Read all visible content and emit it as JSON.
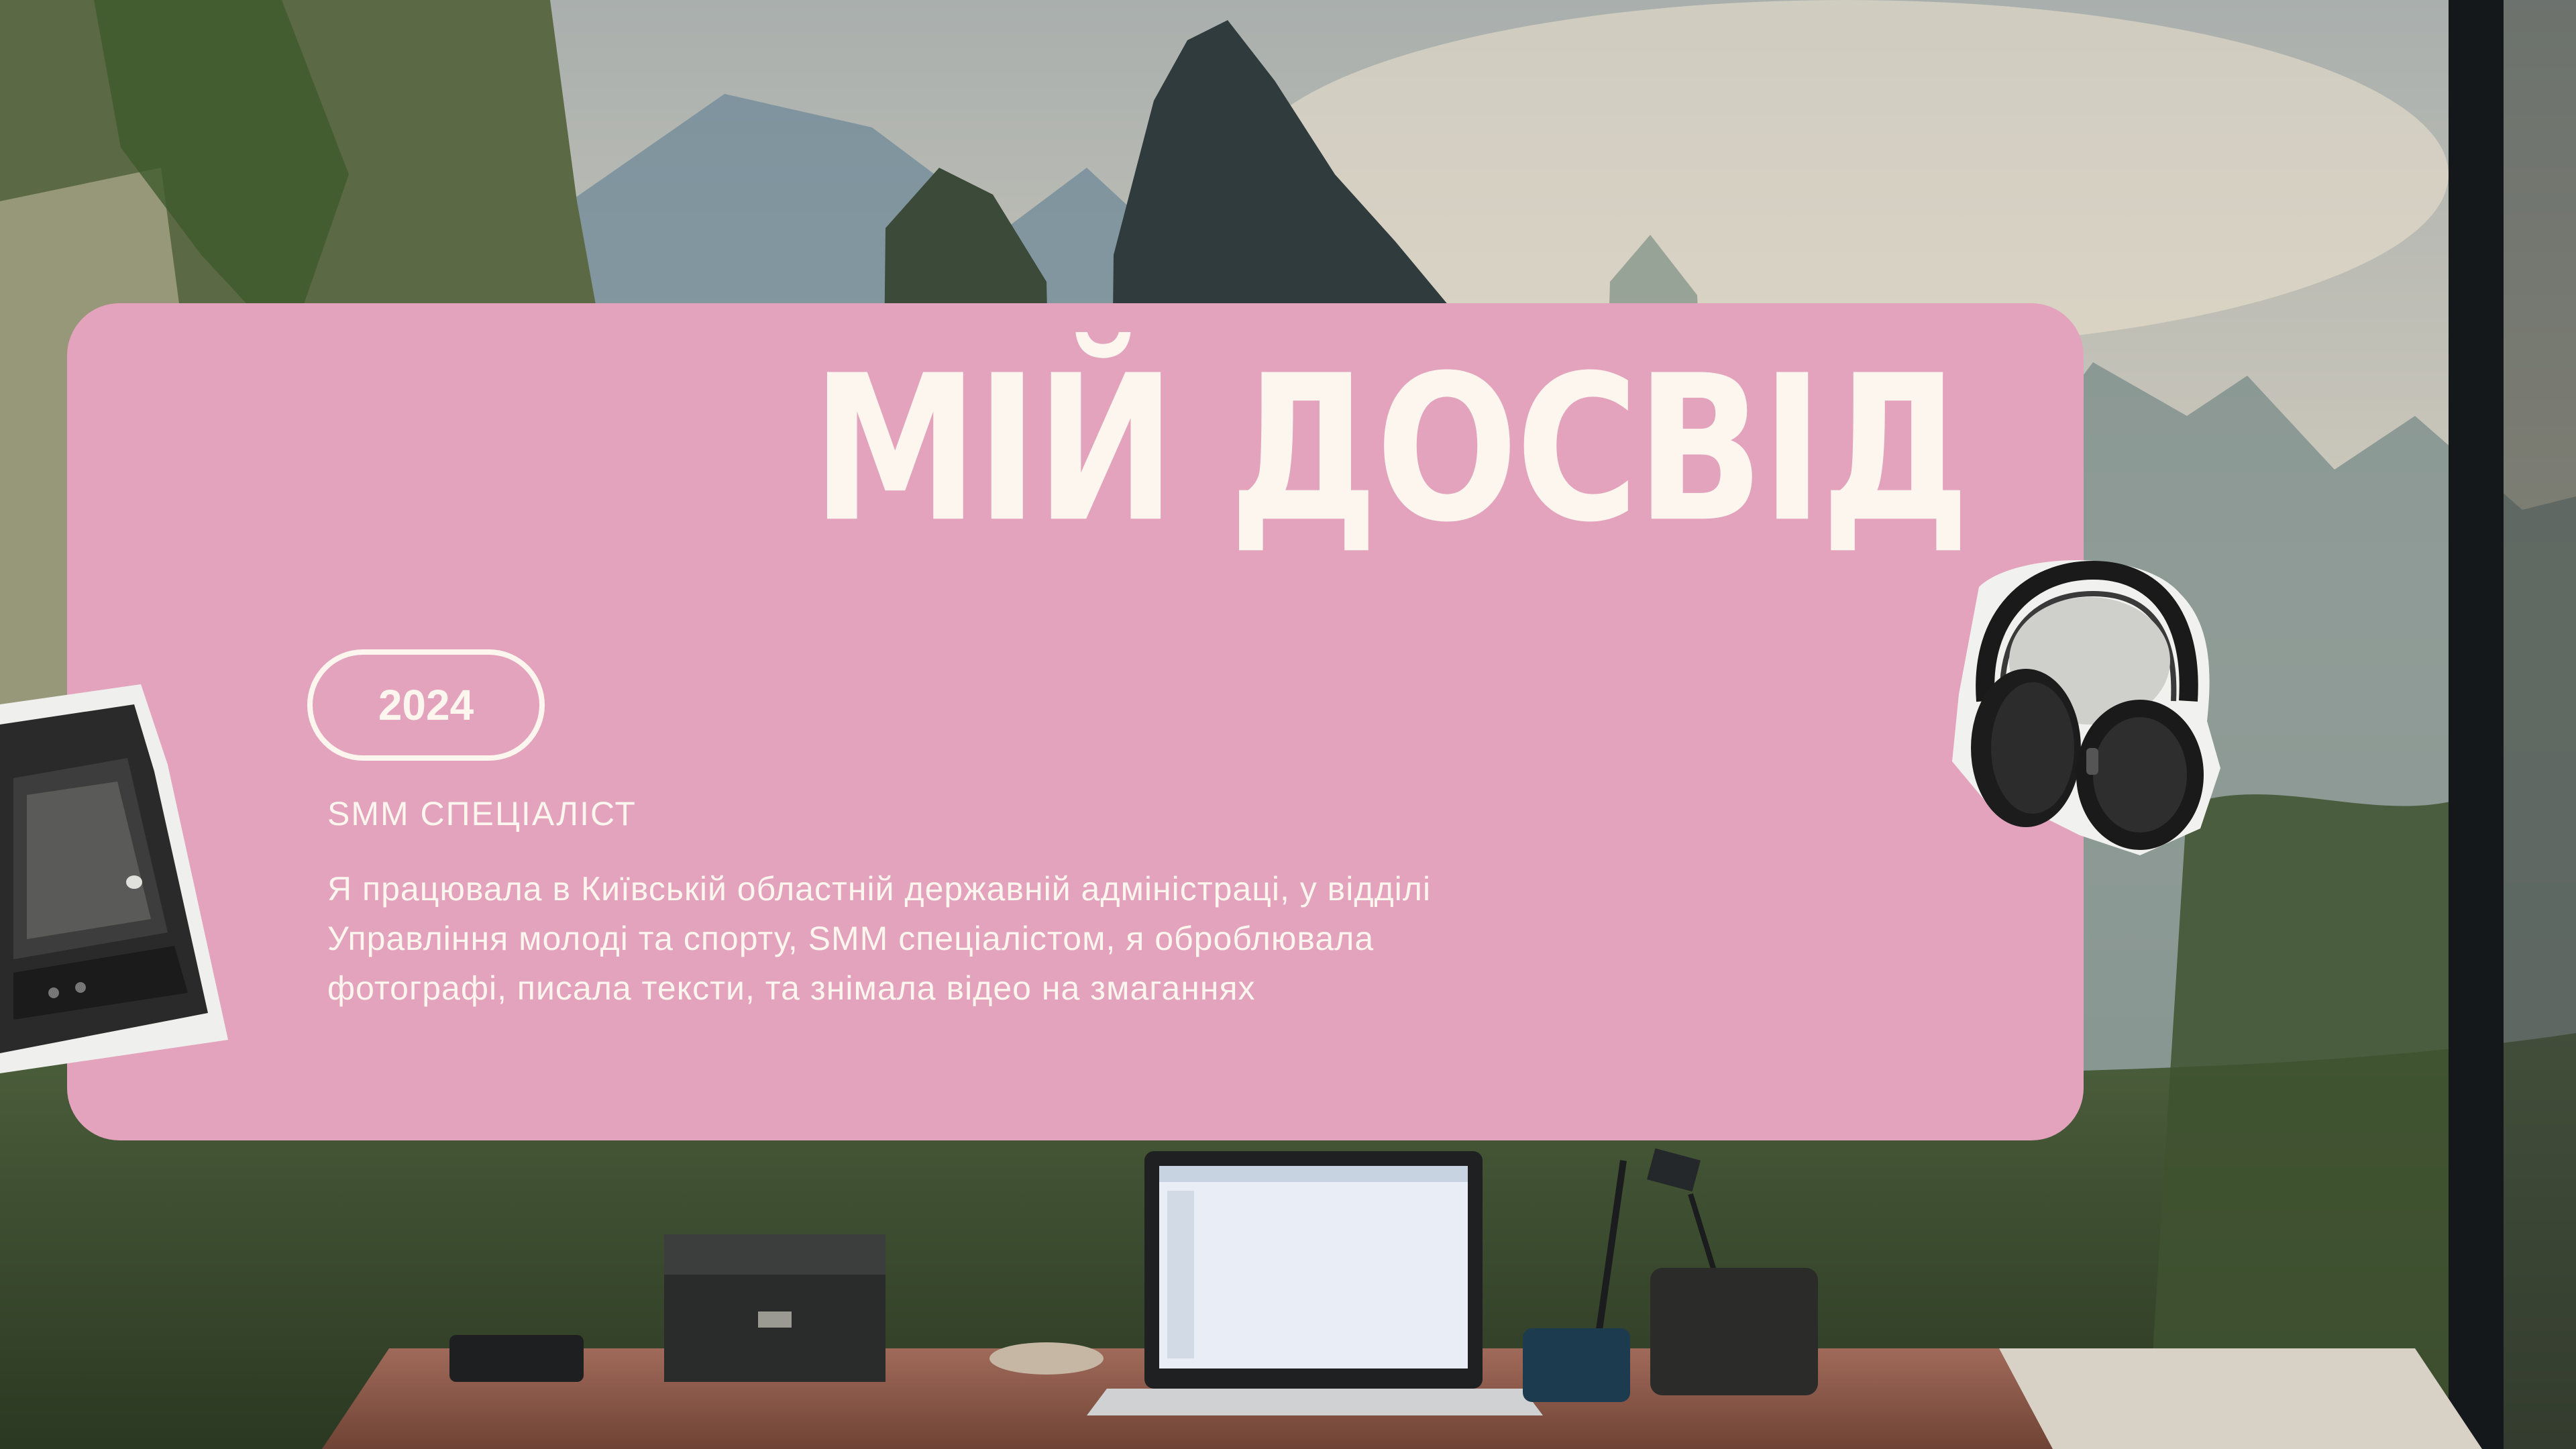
{
  "slide": {
    "title": "МІЙ ДОСВІД",
    "experience": {
      "year": "2024",
      "role": "SMM СПЕЦІАЛІСТ",
      "description": "Я працювала в Київській областній державній адміністраці, у відділі Управління молоді та спорту, SMM спеціалістом, я оброблювала фотографі, писала тексти, та знімала відео на змаганнях"
    }
  },
  "colors": {
    "card": "#e3a3bd",
    "text": "#fdf6ee"
  },
  "decorations": {
    "left_sticker_icon": "retro-tv-icon",
    "right_sticker_icon": "headphones-icon",
    "background": "mountain-landscape-with-desk-and-laptop"
  }
}
